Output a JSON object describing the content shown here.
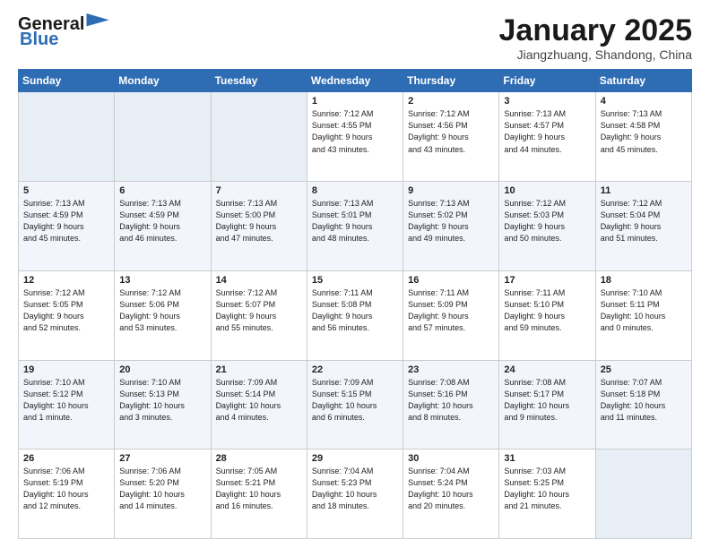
{
  "header": {
    "logo_line1": "General",
    "logo_line2": "Blue",
    "month_title": "January 2025",
    "location": "Jiangzhuang, Shandong, China"
  },
  "weekdays": [
    "Sunday",
    "Monday",
    "Tuesday",
    "Wednesday",
    "Thursday",
    "Friday",
    "Saturday"
  ],
  "weeks": [
    [
      {
        "day": "",
        "info": ""
      },
      {
        "day": "",
        "info": ""
      },
      {
        "day": "",
        "info": ""
      },
      {
        "day": "1",
        "info": "Sunrise: 7:12 AM\nSunset: 4:55 PM\nDaylight: 9 hours\nand 43 minutes."
      },
      {
        "day": "2",
        "info": "Sunrise: 7:12 AM\nSunset: 4:56 PM\nDaylight: 9 hours\nand 43 minutes."
      },
      {
        "day": "3",
        "info": "Sunrise: 7:13 AM\nSunset: 4:57 PM\nDaylight: 9 hours\nand 44 minutes."
      },
      {
        "day": "4",
        "info": "Sunrise: 7:13 AM\nSunset: 4:58 PM\nDaylight: 9 hours\nand 45 minutes."
      }
    ],
    [
      {
        "day": "5",
        "info": "Sunrise: 7:13 AM\nSunset: 4:59 PM\nDaylight: 9 hours\nand 45 minutes."
      },
      {
        "day": "6",
        "info": "Sunrise: 7:13 AM\nSunset: 4:59 PM\nDaylight: 9 hours\nand 46 minutes."
      },
      {
        "day": "7",
        "info": "Sunrise: 7:13 AM\nSunset: 5:00 PM\nDaylight: 9 hours\nand 47 minutes."
      },
      {
        "day": "8",
        "info": "Sunrise: 7:13 AM\nSunset: 5:01 PM\nDaylight: 9 hours\nand 48 minutes."
      },
      {
        "day": "9",
        "info": "Sunrise: 7:13 AM\nSunset: 5:02 PM\nDaylight: 9 hours\nand 49 minutes."
      },
      {
        "day": "10",
        "info": "Sunrise: 7:12 AM\nSunset: 5:03 PM\nDaylight: 9 hours\nand 50 minutes."
      },
      {
        "day": "11",
        "info": "Sunrise: 7:12 AM\nSunset: 5:04 PM\nDaylight: 9 hours\nand 51 minutes."
      }
    ],
    [
      {
        "day": "12",
        "info": "Sunrise: 7:12 AM\nSunset: 5:05 PM\nDaylight: 9 hours\nand 52 minutes."
      },
      {
        "day": "13",
        "info": "Sunrise: 7:12 AM\nSunset: 5:06 PM\nDaylight: 9 hours\nand 53 minutes."
      },
      {
        "day": "14",
        "info": "Sunrise: 7:12 AM\nSunset: 5:07 PM\nDaylight: 9 hours\nand 55 minutes."
      },
      {
        "day": "15",
        "info": "Sunrise: 7:11 AM\nSunset: 5:08 PM\nDaylight: 9 hours\nand 56 minutes."
      },
      {
        "day": "16",
        "info": "Sunrise: 7:11 AM\nSunset: 5:09 PM\nDaylight: 9 hours\nand 57 minutes."
      },
      {
        "day": "17",
        "info": "Sunrise: 7:11 AM\nSunset: 5:10 PM\nDaylight: 9 hours\nand 59 minutes."
      },
      {
        "day": "18",
        "info": "Sunrise: 7:10 AM\nSunset: 5:11 PM\nDaylight: 10 hours\nand 0 minutes."
      }
    ],
    [
      {
        "day": "19",
        "info": "Sunrise: 7:10 AM\nSunset: 5:12 PM\nDaylight: 10 hours\nand 1 minute."
      },
      {
        "day": "20",
        "info": "Sunrise: 7:10 AM\nSunset: 5:13 PM\nDaylight: 10 hours\nand 3 minutes."
      },
      {
        "day": "21",
        "info": "Sunrise: 7:09 AM\nSunset: 5:14 PM\nDaylight: 10 hours\nand 4 minutes."
      },
      {
        "day": "22",
        "info": "Sunrise: 7:09 AM\nSunset: 5:15 PM\nDaylight: 10 hours\nand 6 minutes."
      },
      {
        "day": "23",
        "info": "Sunrise: 7:08 AM\nSunset: 5:16 PM\nDaylight: 10 hours\nand 8 minutes."
      },
      {
        "day": "24",
        "info": "Sunrise: 7:08 AM\nSunset: 5:17 PM\nDaylight: 10 hours\nand 9 minutes."
      },
      {
        "day": "25",
        "info": "Sunrise: 7:07 AM\nSunset: 5:18 PM\nDaylight: 10 hours\nand 11 minutes."
      }
    ],
    [
      {
        "day": "26",
        "info": "Sunrise: 7:06 AM\nSunset: 5:19 PM\nDaylight: 10 hours\nand 12 minutes."
      },
      {
        "day": "27",
        "info": "Sunrise: 7:06 AM\nSunset: 5:20 PM\nDaylight: 10 hours\nand 14 minutes."
      },
      {
        "day": "28",
        "info": "Sunrise: 7:05 AM\nSunset: 5:21 PM\nDaylight: 10 hours\nand 16 minutes."
      },
      {
        "day": "29",
        "info": "Sunrise: 7:04 AM\nSunset: 5:23 PM\nDaylight: 10 hours\nand 18 minutes."
      },
      {
        "day": "30",
        "info": "Sunrise: 7:04 AM\nSunset: 5:24 PM\nDaylight: 10 hours\nand 20 minutes."
      },
      {
        "day": "31",
        "info": "Sunrise: 7:03 AM\nSunset: 5:25 PM\nDaylight: 10 hours\nand 21 minutes."
      },
      {
        "day": "",
        "info": ""
      }
    ]
  ]
}
